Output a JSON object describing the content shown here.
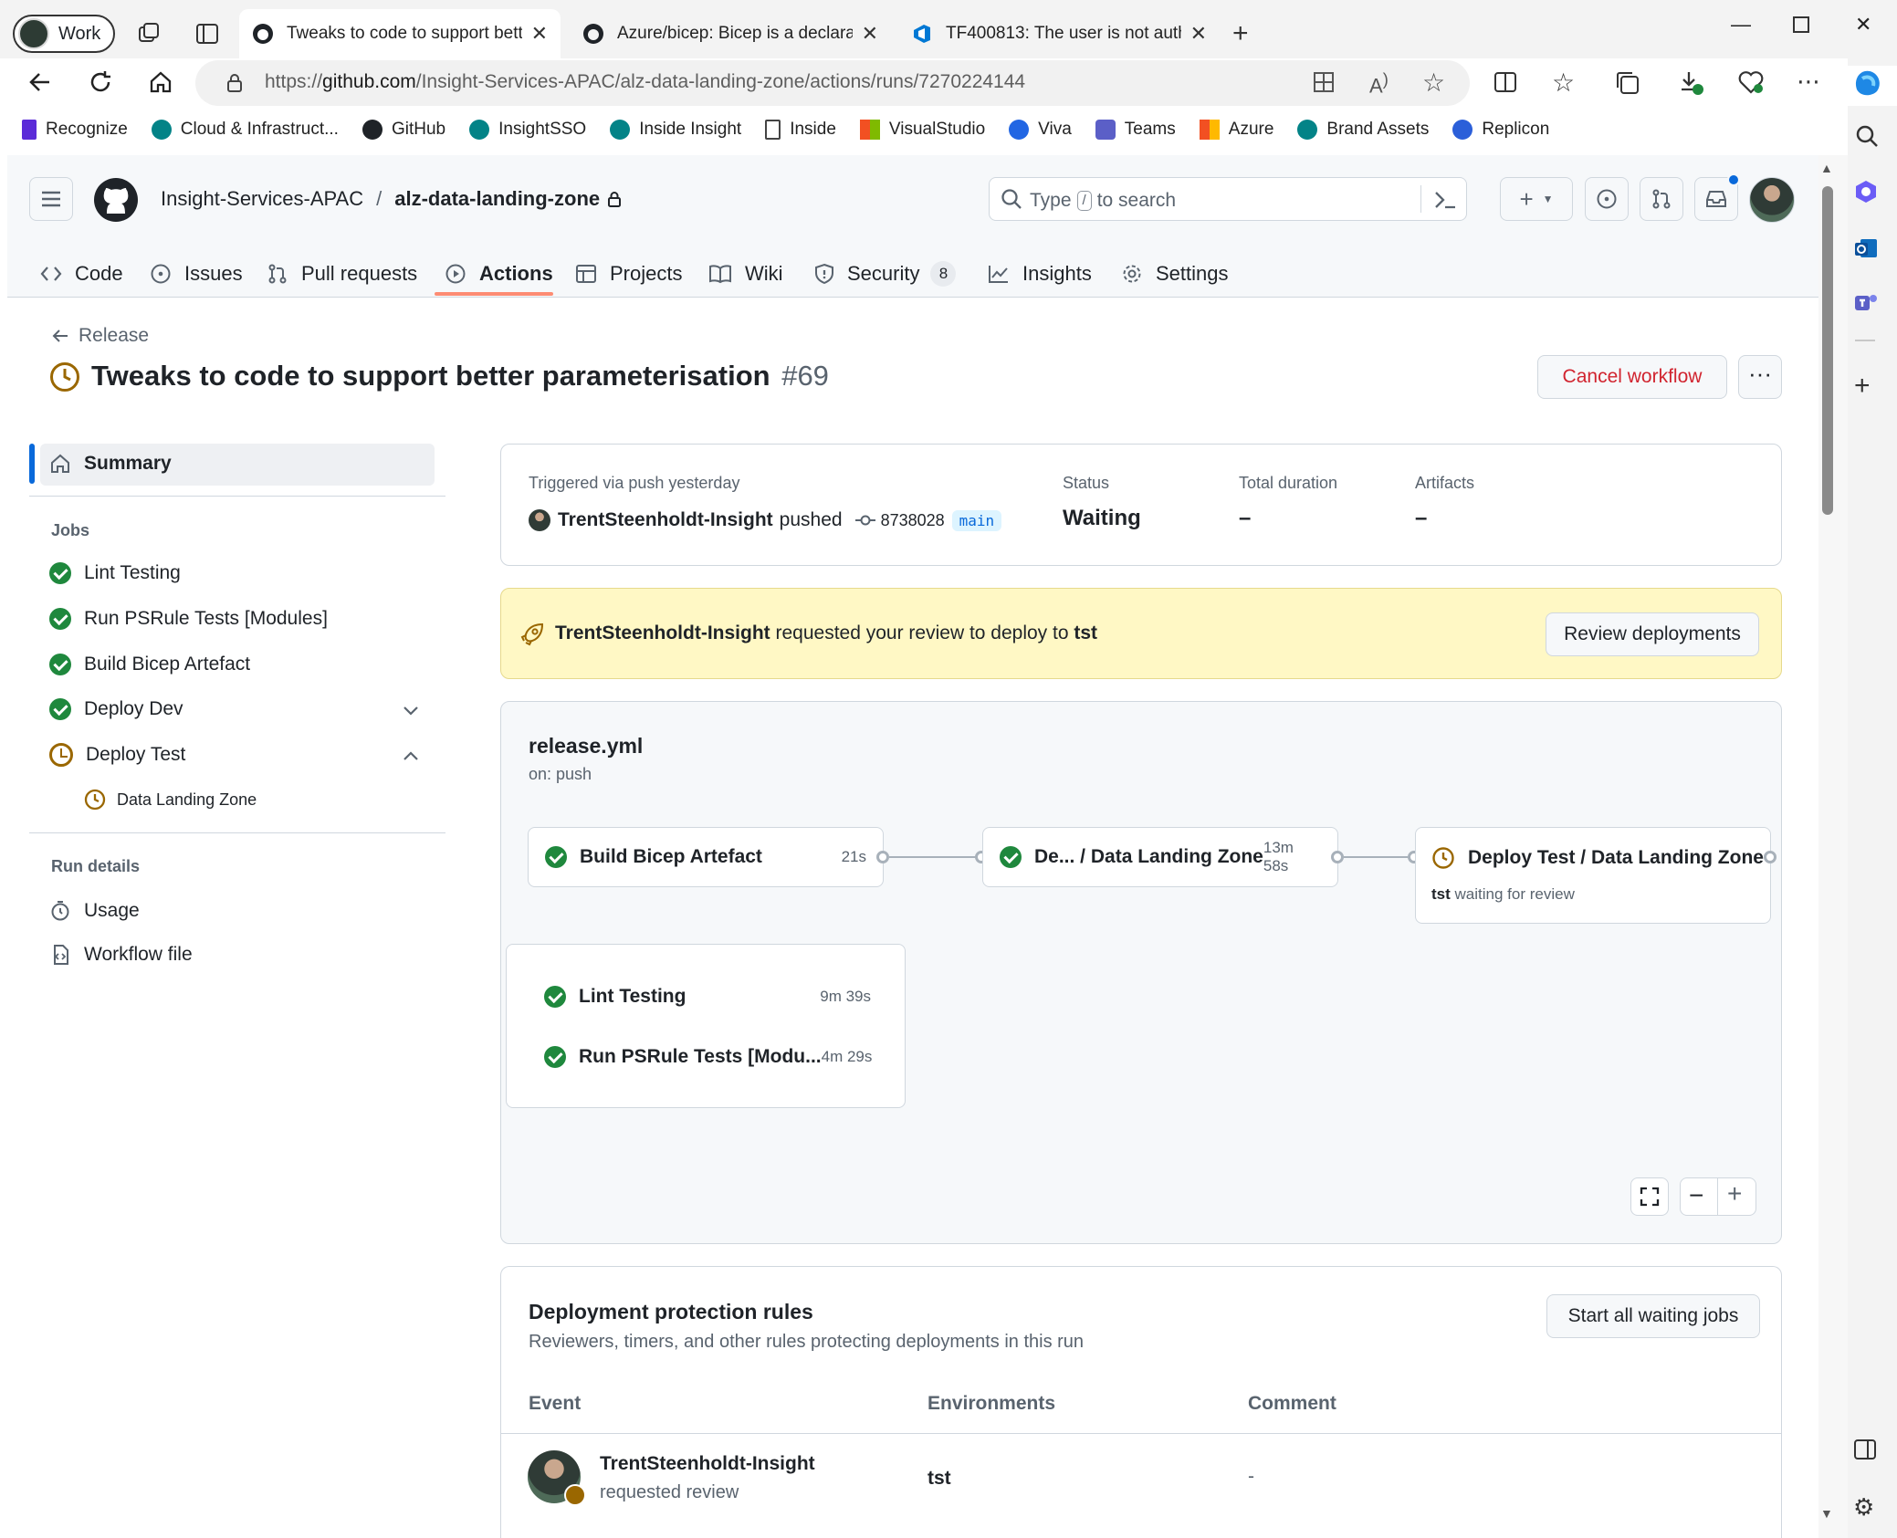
{
  "browser": {
    "profile_label": "Work",
    "tabs": [
      {
        "title": "Tweaks to code to support better parameterisation",
        "active": true
      },
      {
        "title": "Azure/bicep: Bicep is a declarative language"
      },
      {
        "title": "TF400813: The user is not authorized"
      }
    ],
    "url_prefix": "https://",
    "url_host": "github.com",
    "url_path": "/Insight-Services-APAC/alz-data-landing-zone/actions/runs/7270224144",
    "bookmarks": [
      {
        "label": "Recognize",
        "color": "#5b2bd8"
      },
      {
        "label": "Cloud & Infrastruct...",
        "color": "#038387"
      },
      {
        "label": "GitHub",
        "color": "#1f2328"
      },
      {
        "label": "InsightSSO",
        "color": "#038387"
      },
      {
        "label": "Inside Insight",
        "color": "#038387"
      },
      {
        "label": "Inside",
        "color": "#ffffff"
      },
      {
        "label": "VisualStudio",
        "color": "#f25022"
      },
      {
        "label": "Viva",
        "color": "#2266e3"
      },
      {
        "label": "Teams",
        "color": "#5b5fc7"
      },
      {
        "label": "Azure",
        "color": "#f25022"
      },
      {
        "label": "Brand Assets",
        "color": "#038387"
      },
      {
        "label": "Replicon",
        "color": "#2b5fd9"
      }
    ]
  },
  "github": {
    "owner": "Insight-Services-APAC",
    "repo": "alz-data-landing-zone",
    "search_pre": "Type",
    "search_key": "/",
    "search_post": "to search",
    "nav": {
      "code": "Code",
      "issues": "Issues",
      "pull_requests": "Pull requests",
      "actions": "Actions",
      "projects": "Projects",
      "wiki": "Wiki",
      "security": "Security",
      "security_count": "8",
      "insights": "Insights",
      "settings": "Settings"
    },
    "back_label": "Release",
    "run_title": "Tweaks to code to support better parameterisation",
    "run_number": "#69",
    "cancel_label": "Cancel workflow",
    "sidebar": {
      "summary": "Summary",
      "jobs_heading": "Jobs",
      "jobs": [
        "Lint Testing",
        "Run PSRule Tests [Modules]",
        "Build Bicep Artefact",
        "Deploy Dev",
        "Deploy Test"
      ],
      "sub_job": "Data Landing Zone",
      "run_details_heading": "Run details",
      "usage": "Usage",
      "workflow_file": "Workflow file"
    },
    "summary": {
      "trigger_label": "Triggered via push yesterday",
      "actor": "TrentSteenholdt-Insight",
      "action": "pushed",
      "commit": "8738028",
      "branch": "main",
      "status_label": "Status",
      "status_value": "Waiting",
      "duration_label": "Total duration",
      "duration_value": "–",
      "artifacts_label": "Artifacts",
      "artifacts_value": "–"
    },
    "review_banner": {
      "actor": "TrentSteenholdt-Insight",
      "text": "requested your review to deploy to",
      "env": "tst",
      "button": "Review deployments"
    },
    "graph": {
      "file": "release.yml",
      "trigger": "on: push",
      "nodes": [
        {
          "name": "Build Bicep Artefact",
          "time": "21s"
        },
        {
          "name": "De... / Data Landing Zone",
          "time": "13m 58s"
        },
        {
          "name": "Deploy Test / Data Landing Zone",
          "env": "tst",
          "sub": "waiting for review"
        }
      ],
      "group": [
        {
          "name": "Lint Testing",
          "time": "9m 39s"
        },
        {
          "name": "Run PSRule Tests [Modu...",
          "time": "4m 29s"
        }
      ]
    },
    "protection": {
      "title": "Deployment protection rules",
      "subtitle": "Reviewers, timers, and other rules protecting deployments in this run",
      "button": "Start all waiting jobs",
      "headers": [
        "Event",
        "Environments",
        "Comment"
      ],
      "row": {
        "actor": "TrentSteenholdt-Insight",
        "action": "requested review",
        "env": "tst",
        "comment": "-"
      }
    }
  }
}
